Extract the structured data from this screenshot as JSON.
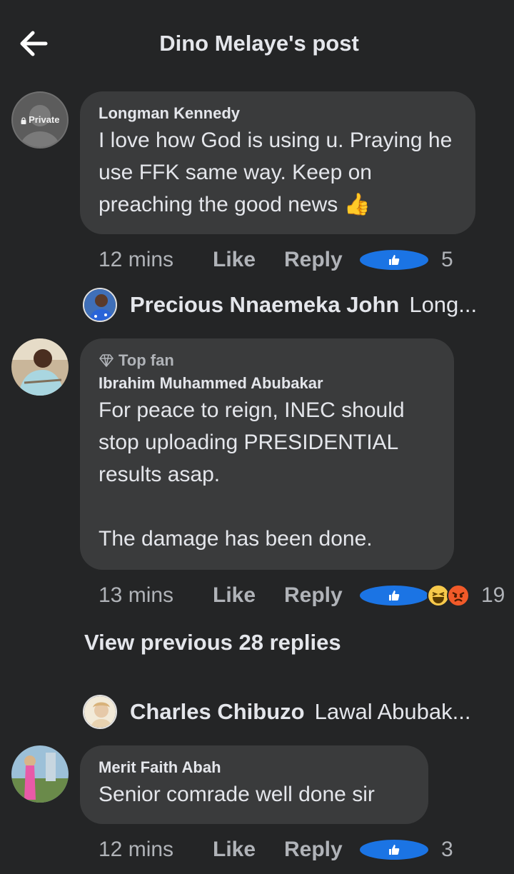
{
  "header": {
    "title": "Dino Melaye's post"
  },
  "comments": [
    {
      "private_label": "Private",
      "author": "Longman Kennedy",
      "text": "I love how God is using u. Praying he use FFK same way. Keep on preaching the good news 👍",
      "time": "12 mins",
      "like_label": "Like",
      "reply_label": "Reply",
      "reaction_count": "5",
      "reactions": [
        "like"
      ]
    },
    {
      "badge": "Top fan",
      "author": "Ibrahim Muhammed Abubakar",
      "text": "For peace to reign, INEC should stop uploading PRESIDENTIAL results asap.\n\nThe damage has been done.",
      "time": "13 mins",
      "like_label": "Like",
      "reply_label": "Reply",
      "reaction_count": "19",
      "reactions": [
        "like",
        "haha",
        "angry"
      ]
    },
    {
      "author": "Merit Faith Abah",
      "text": "Senior comrade well done sir",
      "time": "12 mins",
      "like_label": "Like",
      "reply_label": "Reply",
      "reaction_count": "3",
      "reactions": [
        "like"
      ]
    }
  ],
  "reply_previews": [
    {
      "name": "Precious Nnaemeka John",
      "snippet": "Long..."
    },
    {
      "name": "Charles Chibuzo",
      "snippet": "Lawal Abubak..."
    }
  ],
  "view_previous": "View previous 28 replies",
  "colors": {
    "background": "#242526",
    "bubble": "#3a3b3c",
    "like_blue": "#1b74e4",
    "muted_text": "#b0b3b8"
  }
}
